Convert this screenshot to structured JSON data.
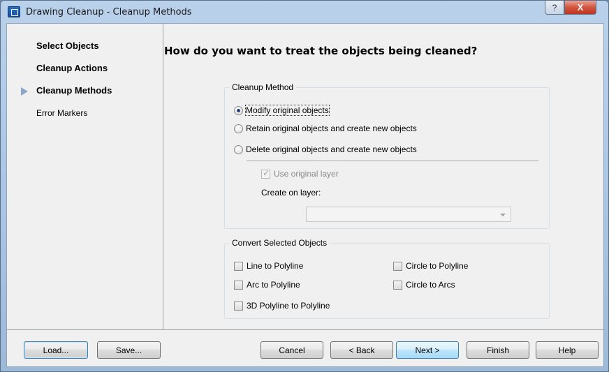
{
  "window": {
    "title": "Drawing Cleanup - Cleanup Methods",
    "help_label": "?",
    "close_label": "X"
  },
  "sidebar": {
    "items": [
      {
        "label": "Select Objects",
        "active": false
      },
      {
        "label": "Cleanup Actions",
        "active": false
      },
      {
        "label": "Cleanup Methods",
        "active": true
      },
      {
        "label": "Error Markers",
        "active": false
      }
    ]
  },
  "main": {
    "heading": "How do you want to treat the objects being cleaned?",
    "cleanup_method": {
      "legend": "Cleanup Method",
      "options": [
        {
          "label": "Modify original objects",
          "selected": true
        },
        {
          "label": "Retain original objects and create new objects",
          "selected": false
        },
        {
          "label": "Delete original objects and create new objects",
          "selected": false
        }
      ],
      "use_original_layer": {
        "label": "Use original layer",
        "checked": true,
        "enabled": false
      },
      "create_on_layer_label": "Create on layer:",
      "layer_value": ""
    },
    "convert": {
      "legend": "Convert Selected Objects",
      "items": [
        {
          "label": "Line to Polyline",
          "checked": false
        },
        {
          "label": "Arc to Polyline",
          "checked": false
        },
        {
          "label": "3D Polyline to Polyline",
          "checked": false
        },
        {
          "label": "Circle to Polyline",
          "checked": false
        },
        {
          "label": "Circle to Arcs",
          "checked": false
        }
      ]
    }
  },
  "buttons": {
    "load": "Load...",
    "save": "Save...",
    "cancel": "Cancel",
    "back": "< Back",
    "next": "Next >",
    "finish": "Finish",
    "help": "Help"
  }
}
